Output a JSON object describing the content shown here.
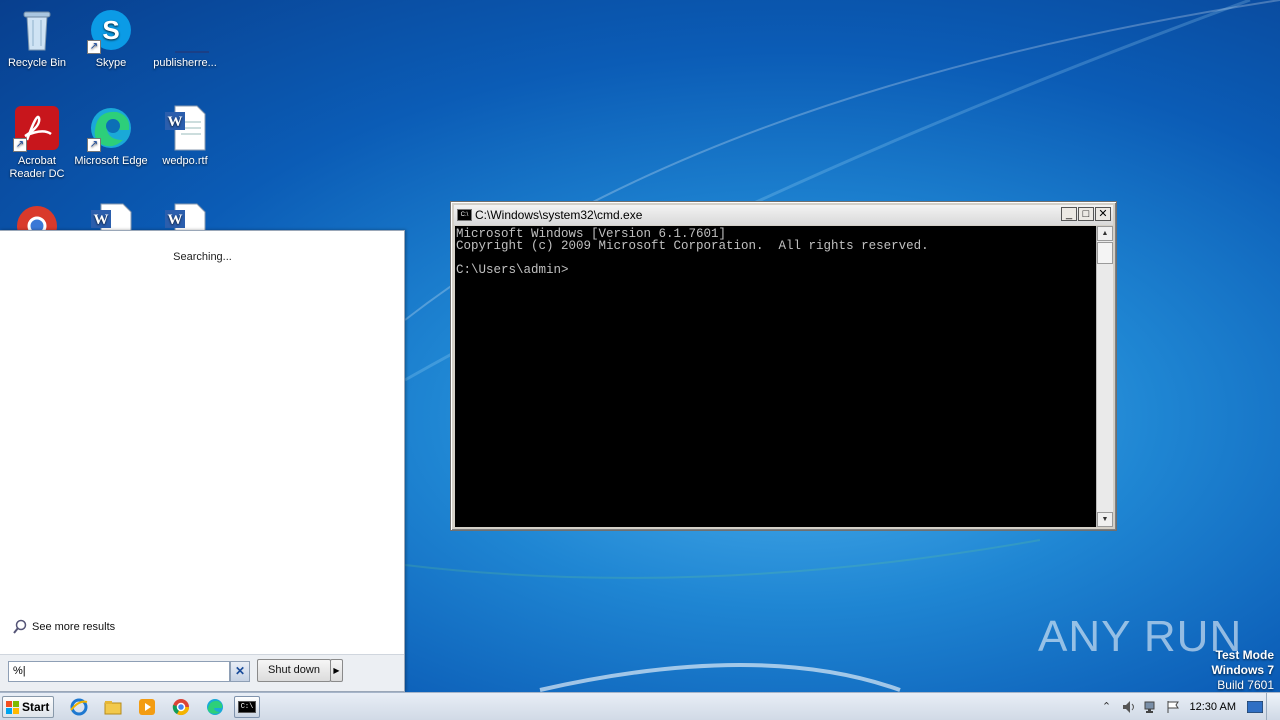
{
  "desktop": {
    "icons": [
      {
        "label": "Recycle Bin"
      },
      {
        "label": "Skype"
      },
      {
        "label": "publisherre..."
      },
      {
        "label": "Acrobat Reader DC"
      },
      {
        "label": "Microsoft Edge"
      },
      {
        "label": "wedpo.rtf"
      }
    ]
  },
  "start_menu": {
    "status": "Searching...",
    "see_more": "See more results",
    "search_value": "%|",
    "clear_glyph": "✕",
    "shutdown_label": "Shut down",
    "shutdown_arrow": "▶"
  },
  "cmd": {
    "title": "C:\\Windows\\system32\\cmd.exe",
    "title_icon": "C:\\",
    "lines": "Microsoft Windows [Version 6.1.7601]\nCopyright (c) 2009 Microsoft Corporation.  All rights reserved.\n\nC:\\Users\\admin>",
    "min_glyph": "_",
    "max_glyph": "□",
    "close_glyph": "✕"
  },
  "watermark": {
    "text": "ANY RUN"
  },
  "test_mode": {
    "line1": "Test Mode",
    "line2": "Windows 7",
    "line3": "Build 7601"
  },
  "taskbar": {
    "start_label": "Start",
    "cmd_icon_text": "C:\\",
    "clock": "12:30 AM"
  }
}
